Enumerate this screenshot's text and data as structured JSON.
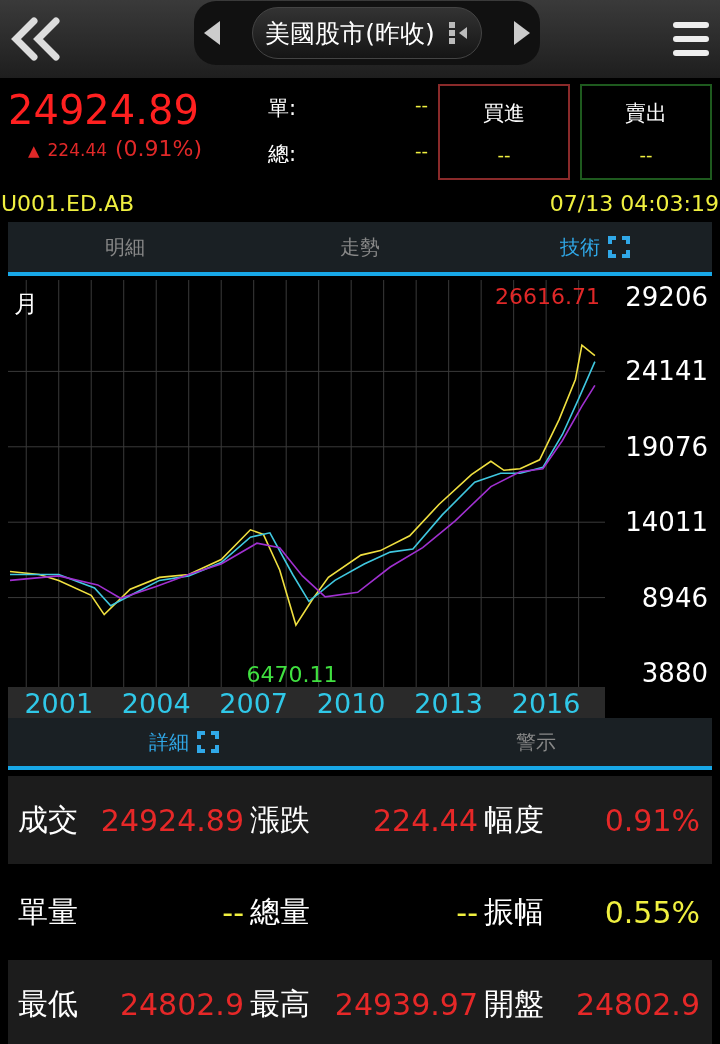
{
  "header": {
    "title": "美國股市(昨收)"
  },
  "quote": {
    "price": "24924.89",
    "change_arrow": "▲",
    "change": "224.44",
    "change_pct": "(0.91%)",
    "fields": [
      {
        "label": "單:",
        "value": "--"
      },
      {
        "label": "總:",
        "value": "--"
      }
    ],
    "orders": [
      {
        "label": "買進",
        "value": "--",
        "kind": "buy"
      },
      {
        "label": "賣出",
        "value": "--",
        "kind": "sell"
      }
    ],
    "code": "U001.ED.AB",
    "time": "07/13 04:03:19"
  },
  "tabs": [
    {
      "label": "明細",
      "selected": false,
      "expand_icon": false
    },
    {
      "label": "走勢",
      "selected": false,
      "expand_icon": false
    },
    {
      "label": "技術",
      "selected": true,
      "expand_icon": true
    }
  ],
  "chart": {
    "period": "月",
    "chart_data": {
      "type": "line",
      "grid": true,
      "xlim": [
        1999.5,
        2017.75
      ],
      "ylim": [
        3880,
        29206
      ],
      "yticks": [
        3880,
        8946,
        14011,
        19076,
        24141,
        29206
      ],
      "xticks": [
        2001,
        2004,
        2007,
        2010,
        2013,
        2016
      ],
      "series": [
        {
          "color": "#f0e040",
          "x": [
            1999.5,
            2000.4,
            2001.0,
            2002.0,
            2002.4,
            2003.2,
            2004.1,
            2005.0,
            2006.0,
            2006.9,
            2007.3,
            2007.8,
            2008.3,
            2008.8,
            2009.3,
            2010.3,
            2010.9,
            2011.8,
            2012.7,
            2013.7,
            2014.3,
            2014.7,
            2015.2,
            2015.8,
            2016.4,
            2016.9,
            2017.1,
            2017.5
          ],
          "values": [
            10700,
            10500,
            10100,
            9100,
            7800,
            9500,
            10300,
            10500,
            11500,
            13500,
            13200,
            10800,
            7100,
            8800,
            10300,
            11800,
            12100,
            13100,
            15200,
            17200,
            18100,
            17500,
            17600,
            18200,
            20900,
            23600,
            25900,
            25200
          ]
        },
        {
          "color": "#40c8e0",
          "x": [
            1999.5,
            2001,
            2002.1,
            2002.6,
            2003.3,
            2004.1,
            2005,
            2006,
            2006.9,
            2007.5,
            2008.2,
            2008.7,
            2009.5,
            2010.4,
            2011.2,
            2011.9,
            2012.8,
            2013.8,
            2014.6,
            2015.2,
            2015.9,
            2016.5,
            2017,
            2017.5
          ],
          "values": [
            10500,
            10500,
            9600,
            8400,
            9200,
            10100,
            10400,
            11300,
            13000,
            13300,
            10500,
            8700,
            10100,
            11200,
            12000,
            12200,
            14500,
            16700,
            17300,
            17300,
            17700,
            19900,
            22300,
            24800
          ]
        },
        {
          "color": "#a030d0",
          "x": [
            1999.5,
            2001,
            2002.2,
            2002.9,
            2004,
            2005,
            2006,
            2007.1,
            2007.8,
            2008.5,
            2009.2,
            2010.2,
            2011.2,
            2012.2,
            2013.2,
            2014.3,
            2015.2,
            2015.9,
            2016.5,
            2017.1,
            2017.5
          ],
          "values": [
            10100,
            10400,
            9800,
            8900,
            9700,
            10500,
            11200,
            12600,
            12300,
            10400,
            9000,
            9300,
            11000,
            12300,
            14100,
            16400,
            17400,
            17600,
            19500,
            21800,
            23200
          ]
        }
      ],
      "annotations": [
        "26616.71",
        "6470.11"
      ]
    }
  },
  "detail_tabs": [
    {
      "label": "詳細",
      "selected": true,
      "expand_icon": true
    },
    {
      "label": "警示",
      "selected": false,
      "expand_icon": false
    }
  ],
  "stats": [
    [
      {
        "label": "成交",
        "value": "24924.89",
        "color": "#e62828"
      },
      {
        "label": "漲跌",
        "value": "224.44",
        "color": "#e62828"
      },
      {
        "label": "幅度",
        "value": "0.91%",
        "color": "#e62828"
      }
    ],
    [
      {
        "label": "單量",
        "value": "--",
        "color": "#f0f040"
      },
      {
        "label": "總量",
        "value": "--",
        "color": "#f0f040"
      },
      {
        "label": "振幅",
        "value": "0.55%",
        "color": "#f0f040"
      }
    ],
    [
      {
        "label": "最低",
        "value": "24802.9",
        "color": "#e62828"
      },
      {
        "label": "最高",
        "value": "24939.97",
        "color": "#e62828"
      },
      {
        "label": "開盤",
        "value": "24802.9",
        "color": "#e62828"
      }
    ]
  ]
}
